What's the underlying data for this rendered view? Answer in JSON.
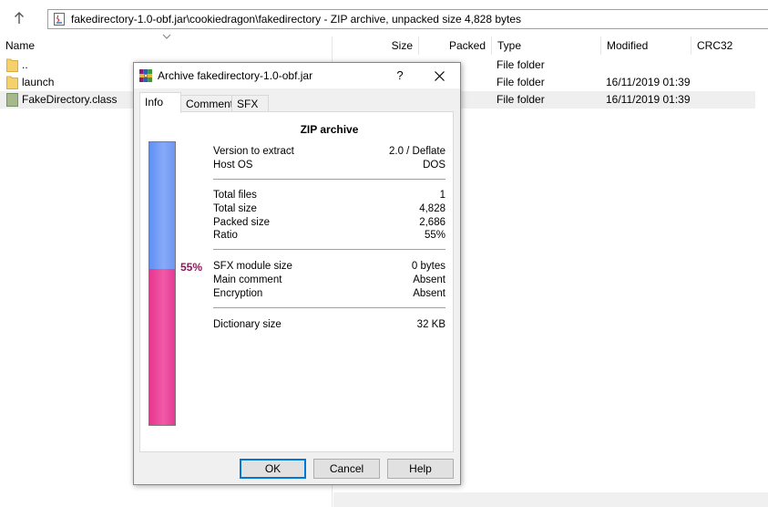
{
  "address": {
    "path": "fakedirectory-1.0-obf.jar\\cookiedragon\\fakedirectory - ZIP archive, unpacked size 4,828 bytes"
  },
  "columns": {
    "name": "Name",
    "size": "Size",
    "packed": "Packed",
    "type": "Type",
    "modified": "Modified",
    "crc": "CRC32"
  },
  "files": [
    {
      "name": "..",
      "type": "File folder",
      "modified": "",
      "icon": "folder-icon"
    },
    {
      "name": "launch",
      "type": "File folder",
      "modified": "16/11/2019 01:39",
      "icon": "folder-icon"
    },
    {
      "name": "FakeDirectory.class",
      "type": "File folder",
      "modified": "16/11/2019 01:39",
      "icon": "class-file-icon"
    }
  ],
  "dialog": {
    "title": "Archive fakedirectory-1.0-obf.jar",
    "help": "?",
    "tabs": [
      "Info",
      "Comment",
      "SFX"
    ],
    "active_tab": "Info",
    "heading": "ZIP archive",
    "ratio_label": "55%",
    "ratio_fraction": 0.55,
    "group1": [
      {
        "k": "Version to extract",
        "v": "2.0 / Deflate"
      },
      {
        "k": "Host OS",
        "v": "DOS"
      }
    ],
    "group2": [
      {
        "k": "Total files",
        "v": "1"
      },
      {
        "k": "Total size",
        "v": "4,828"
      },
      {
        "k": "Packed size",
        "v": "2,686"
      },
      {
        "k": "Ratio",
        "v": "55%"
      }
    ],
    "group3": [
      {
        "k": "SFX module size",
        "v": "0 bytes"
      },
      {
        "k": "Main comment",
        "v": "Absent"
      },
      {
        "k": "Encryption",
        "v": "Absent"
      }
    ],
    "group4": [
      {
        "k": "Dictionary size",
        "v": "32 KB"
      }
    ],
    "buttons": {
      "ok": "OK",
      "cancel": "Cancel",
      "help": "Help"
    }
  },
  "colors": {
    "bar_top": "#6f96f2",
    "bar_bottom": "#e8358e",
    "ratio_text": "#8b1a5a",
    "accent": "#0078d7",
    "folder": "#f5d06b"
  }
}
